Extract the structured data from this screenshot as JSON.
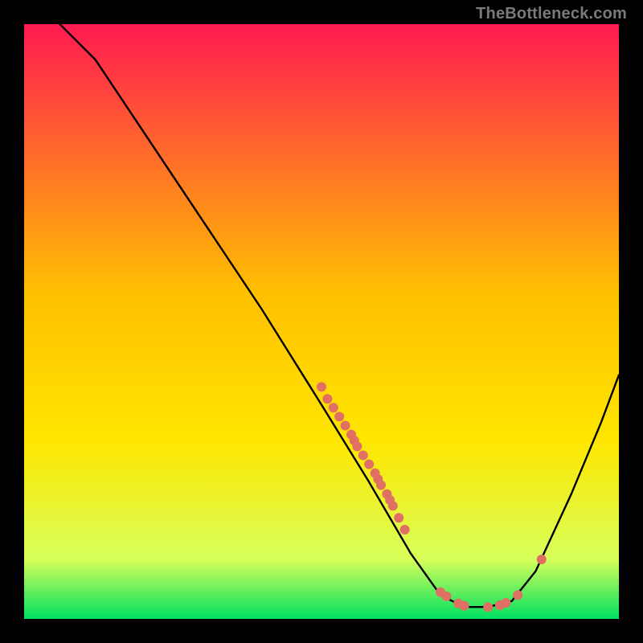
{
  "watermark": "TheBottleneck.com",
  "colors": {
    "gradient_top": "#ff1a52",
    "gradient_mid": "#ffe600",
    "gradient_bottom": "#00e060",
    "curve": "#000000",
    "marker": "#e07063",
    "background": "#000000"
  },
  "chart_data": {
    "type": "line",
    "title": "",
    "xlabel": "",
    "ylabel": "",
    "xlim": [
      0,
      100
    ],
    "ylim": [
      0,
      100
    ],
    "grid": false,
    "legend": false,
    "curve": [
      {
        "x": 0,
        "y": 110
      },
      {
        "x": 5,
        "y": 101
      },
      {
        "x": 12,
        "y": 94
      },
      {
        "x": 20,
        "y": 82
      },
      {
        "x": 30,
        "y": 67
      },
      {
        "x": 40,
        "y": 52
      },
      {
        "x": 50,
        "y": 36
      },
      {
        "x": 58,
        "y": 23
      },
      {
        "x": 65,
        "y": 11
      },
      {
        "x": 70,
        "y": 4
      },
      {
        "x": 74,
        "y": 2
      },
      {
        "x": 78,
        "y": 2
      },
      {
        "x": 82,
        "y": 3
      },
      {
        "x": 86,
        "y": 8
      },
      {
        "x": 92,
        "y": 21
      },
      {
        "x": 97,
        "y": 33
      },
      {
        "x": 100,
        "y": 41
      }
    ],
    "markers": [
      {
        "x": 50,
        "y": 39
      },
      {
        "x": 51,
        "y": 37
      },
      {
        "x": 52,
        "y": 35.5
      },
      {
        "x": 53,
        "y": 34
      },
      {
        "x": 54,
        "y": 32.5
      },
      {
        "x": 55,
        "y": 31
      },
      {
        "x": 55.5,
        "y": 30
      },
      {
        "x": 56,
        "y": 29
      },
      {
        "x": 57,
        "y": 27.5
      },
      {
        "x": 58,
        "y": 26
      },
      {
        "x": 59,
        "y": 24.5
      },
      {
        "x": 59.5,
        "y": 23.5
      },
      {
        "x": 60,
        "y": 22.5
      },
      {
        "x": 61,
        "y": 21
      },
      {
        "x": 61.5,
        "y": 20
      },
      {
        "x": 62,
        "y": 19
      },
      {
        "x": 63,
        "y": 17
      },
      {
        "x": 64,
        "y": 15
      },
      {
        "x": 70,
        "y": 4.5
      },
      {
        "x": 71,
        "y": 3.8
      },
      {
        "x": 73,
        "y": 2.6
      },
      {
        "x": 74,
        "y": 2.2
      },
      {
        "x": 78,
        "y": 2.0
      },
      {
        "x": 80,
        "y": 2.3
      },
      {
        "x": 81,
        "y": 2.7
      },
      {
        "x": 83,
        "y": 4.0
      },
      {
        "x": 87,
        "y": 10
      }
    ]
  }
}
